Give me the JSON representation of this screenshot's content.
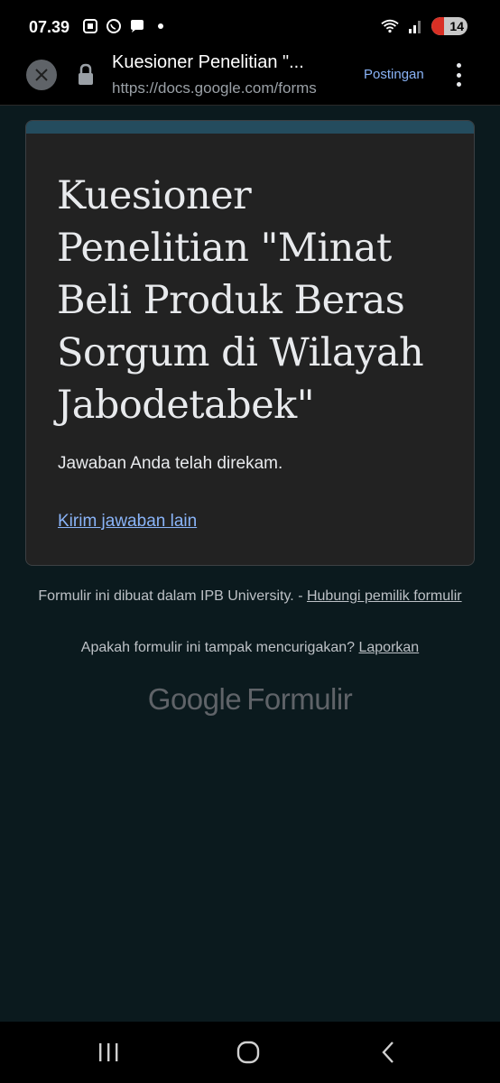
{
  "status_bar": {
    "time": "07.39",
    "battery": "14",
    "icons_left": [
      "screenshot-icon",
      "whatsapp-icon",
      "chat-icon",
      "dot-icon"
    ],
    "icons_right": [
      "wifi-icon",
      "signal-icon",
      "battery-icon"
    ]
  },
  "browser": {
    "tab_title": "Kuesioner Penelitian \"...",
    "url": "https://docs.google.com/forms",
    "action_label": "Postingan"
  },
  "form": {
    "accent_color": "#244c5e",
    "title": "Kuesioner Penelitian \"Minat Beli Produk Beras Sorgum di Wilayah Jabodetabek\"",
    "confirmation": "Jawaban Anda telah direkam.",
    "submit_another": "Kirim jawaban lain"
  },
  "footer": {
    "created_text": "Formulir ini dibuat dalam IPB University. - ",
    "contact_link": "Hubungi pemilik formulir",
    "suspicious_text": "Apakah formulir ini tampak mencurigakan? ",
    "report_link": "Laporkan",
    "logo_google": "Google",
    "logo_forms": "Formulir"
  },
  "colors": {
    "background": "#0b1a1e",
    "card": "#222222",
    "link": "#8ab4f8"
  }
}
